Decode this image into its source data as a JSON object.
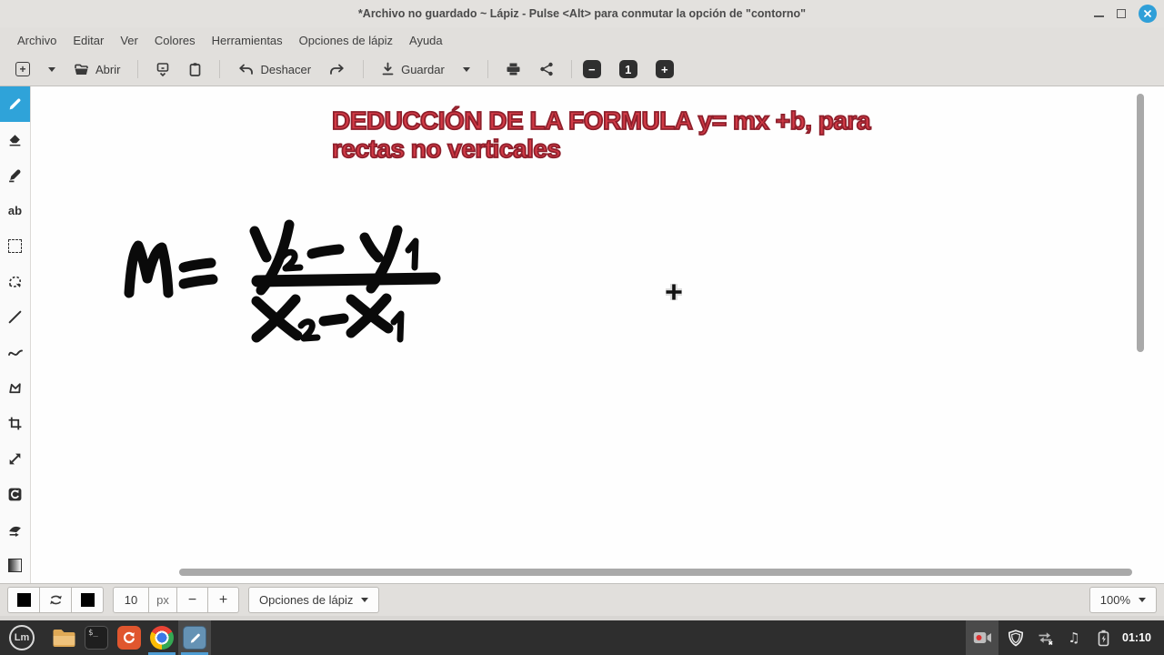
{
  "window": {
    "title": "*Archivo no guardado ~ Lápiz - Pulse <Alt> para conmutar la opción de \"contorno\""
  },
  "menubar": {
    "items": [
      "Archivo",
      "Editar",
      "Ver",
      "Colores",
      "Herramientas",
      "Opciones de lápiz",
      "Ayuda"
    ]
  },
  "toolbar": {
    "new_glyph": "+",
    "open_label": "Abrir",
    "undo_label": "Deshacer",
    "save_label": "Guardar",
    "zoom_out_glyph": "−",
    "zoom_reset_label": "1",
    "zoom_in_glyph": "+"
  },
  "sidebar": {
    "selected_tool": "pencil",
    "text_tool_glyph": "ab",
    "tools": [
      "pencil",
      "eraser",
      "highlighter",
      "text",
      "rectangle-select",
      "free-select",
      "line",
      "curve",
      "shape",
      "crop",
      "scale",
      "rotate",
      "deform",
      "gradient"
    ]
  },
  "canvas": {
    "heading_line1": "DEDUCCIÓN DE LA FORMULA  y= mx +b, para",
    "heading_line2": "rectas no verticales",
    "heading_fill_color": "#d23a46",
    "heading_outline_color": "#8e1f2b",
    "formula": "m = (y₂ − y₁) / (x₂ − x₁)",
    "ink_color": "#000000"
  },
  "options_bar": {
    "size_value": "10",
    "size_unit": "px",
    "decrease_glyph": "−",
    "increase_glyph": "+",
    "pen_options_label": "Opciones de lápiz",
    "zoom_level": "100%"
  },
  "taskbar": {
    "mint_glyph": "Lm",
    "terminal_glyph": "$_",
    "music_glyph": "♫",
    "clock": "01:10"
  },
  "colors": {
    "accent_blue": "#2fa3d9",
    "close_button": "#2f9fd8",
    "taskbar_indicator": "#4e9cd3"
  }
}
